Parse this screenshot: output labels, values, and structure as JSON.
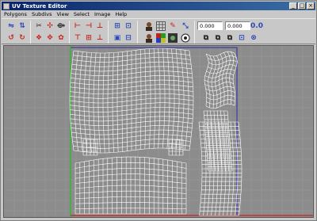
{
  "window": {
    "title": "UV Texture Editor"
  },
  "menu": [
    "Polygons",
    "Subdivs",
    "View",
    "Select",
    "Image",
    "Help"
  ],
  "fields": {
    "u_value": "0.000",
    "v_value": "0.000"
  },
  "colors": {
    "title_bar": "#0a246a",
    "grid_bg": "#8c8c8c",
    "wireframe": "#ffffff",
    "u_axis": "#d02020",
    "v_axis": "#20c020",
    "uv_border": "#2a2ab0"
  }
}
